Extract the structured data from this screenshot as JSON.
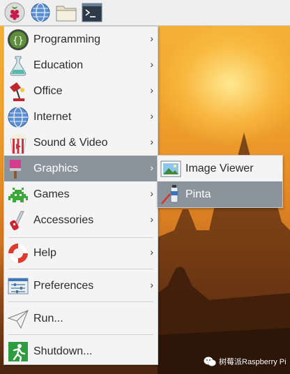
{
  "taskbar": {
    "items": [
      {
        "name": "raspberry-menu-button",
        "icon": "raspberry-icon"
      },
      {
        "name": "web-browser-button",
        "icon": "globe-icon"
      },
      {
        "name": "file-manager-button",
        "icon": "folder-icon"
      },
      {
        "name": "terminal-button",
        "icon": "terminal-icon"
      }
    ]
  },
  "menu": {
    "items": [
      {
        "label": "Programming",
        "icon": "programming-icon",
        "has_submenu": true
      },
      {
        "label": "Education",
        "icon": "flask-icon",
        "has_submenu": true
      },
      {
        "label": "Office",
        "icon": "office-icon",
        "has_submenu": true
      },
      {
        "label": "Internet",
        "icon": "globe-icon",
        "has_submenu": true
      },
      {
        "label": "Sound & Video",
        "icon": "popcorn-icon",
        "has_submenu": true
      },
      {
        "label": "Graphics",
        "icon": "paintbrush-icon",
        "has_submenu": true,
        "active": true
      },
      {
        "label": "Games",
        "icon": "space-invader-icon",
        "has_submenu": true
      },
      {
        "label": "Accessories",
        "icon": "pocket-knife-icon",
        "has_submenu": true
      },
      {
        "label": "Help",
        "icon": "lifebuoy-icon",
        "has_submenu": true
      },
      {
        "label": "Preferences",
        "icon": "settings-panel-icon",
        "has_submenu": true
      },
      {
        "label": "Run...",
        "icon": "paper-plane-icon",
        "has_submenu": false
      },
      {
        "label": "Shutdown...",
        "icon": "exit-icon",
        "has_submenu": false
      }
    ],
    "chevron": "›"
  },
  "submenu": {
    "items": [
      {
        "label": "Image Viewer",
        "icon": "image-viewer-icon"
      },
      {
        "label": "Pinta",
        "icon": "paint-tube-icon",
        "active": true
      }
    ]
  },
  "watermark": {
    "text": "树莓派Raspberry Pi",
    "icon": "wechat-icon"
  },
  "colors": {
    "active_bg": "#8b949c",
    "menu_bg": "#f4f4f4",
    "taskbar_bg": "#efefef"
  }
}
